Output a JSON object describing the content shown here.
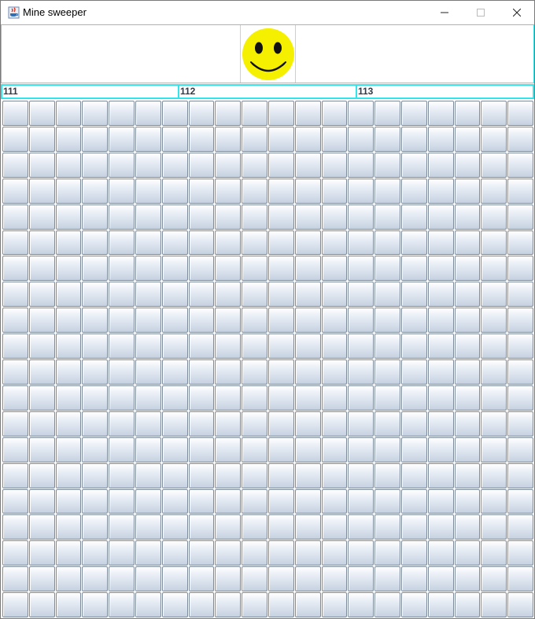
{
  "window": {
    "title": "Mine sweeper",
    "icon": "java-cup-icon",
    "controls": [
      "minimize-icon",
      "maximize-icon",
      "close-icon"
    ]
  },
  "header": {
    "face": "smiley-face-icon",
    "face_color": "#f5f000",
    "border_color": "#33e4ea"
  },
  "counters": [
    "111",
    "112",
    "113"
  ],
  "board": {
    "rows": 20,
    "cols": 20,
    "cell_state": "unrevealed"
  }
}
